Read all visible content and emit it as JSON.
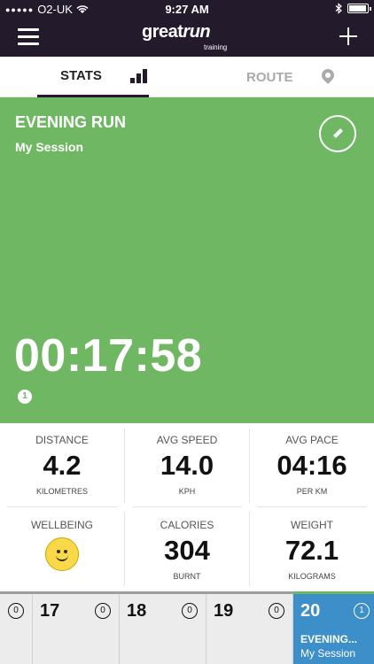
{
  "status_bar": {
    "carrier": "O2-UK",
    "time": "9:27 AM"
  },
  "nav": {
    "logo_main": "great",
    "logo_script": "run",
    "logo_sub": "training"
  },
  "tabs": [
    {
      "label": "STATS",
      "icon": "bar-chart-icon",
      "active": true
    },
    {
      "label": "ROUTE",
      "icon": "map-pin-icon",
      "active": false
    }
  ],
  "session": {
    "name": "EVENING RUN",
    "subtitle": "My Session",
    "duration": "00:17:58",
    "badge_count": "1"
  },
  "stats": {
    "distance": {
      "label": "DISTANCE",
      "value": "4.2",
      "unit": "KILOMETRES"
    },
    "avg_speed": {
      "label": "AVG SPEED",
      "value": "14.0",
      "unit": "KPH"
    },
    "avg_pace": {
      "label": "AVG PACE",
      "value": "04:16",
      "unit": "PER KM"
    },
    "wellbeing": {
      "label": "WELLBEING",
      "icon": "smiley-face-icon"
    },
    "calories": {
      "label": "CALORIES",
      "value": "304",
      "unit": "BURNT"
    },
    "weight": {
      "label": "WEIGHT",
      "value": "72.1",
      "unit": "KILOGRAMS"
    }
  },
  "days": [
    {
      "number": "",
      "badge": "0"
    },
    {
      "number": "17",
      "badge": "0"
    },
    {
      "number": "18",
      "badge": "0"
    },
    {
      "number": "19",
      "badge": "0"
    },
    {
      "number": "20",
      "badge": "1",
      "title": "EVENING...",
      "subtitle": "My Session",
      "active": true
    }
  ],
  "colors": {
    "nav_bg": "#231a2c",
    "hero_green": "#6fb762",
    "active_day_blue": "#3d8fc9",
    "smiley_yellow": "#f9d84a"
  }
}
